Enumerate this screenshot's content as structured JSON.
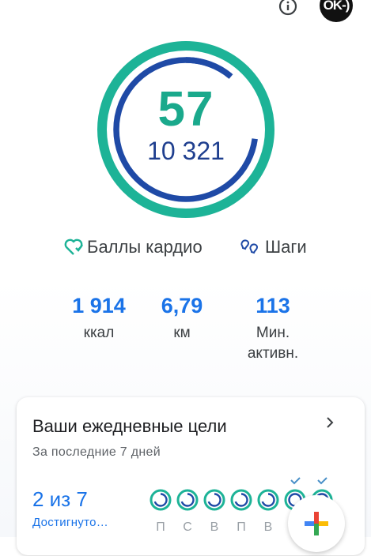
{
  "header": {
    "info_icon": "info-icon",
    "avatar_text": "OK-)"
  },
  "ring": {
    "cardio_points": "57",
    "steps": "10 321",
    "colors": {
      "cardio": "#1db397",
      "steps": "#1f4aa6"
    }
  },
  "legend": {
    "cardio_label": "Баллы кардио",
    "steps_label": "Шаги"
  },
  "stats": [
    {
      "value": "1 914",
      "unit": "ккал"
    },
    {
      "value": "6,79",
      "unit": "км"
    },
    {
      "value": "113",
      "unit": "Мин.\nактивн."
    }
  ],
  "goals_card": {
    "title": "Ваши ежедневные цели",
    "subtitle": "За последние 7 дней",
    "count": "2 из 7",
    "reached_label": "Достигнуто…",
    "days": [
      {
        "label": "П",
        "achieved": false
      },
      {
        "label": "С",
        "achieved": false
      },
      {
        "label": "В",
        "achieved": false
      },
      {
        "label": "П",
        "achieved": false
      },
      {
        "label": "В",
        "achieved": false
      },
      {
        "label": "",
        "achieved": true
      },
      {
        "label": "",
        "achieved": true
      }
    ]
  },
  "fab": {
    "icon": "add-plus-icon"
  }
}
